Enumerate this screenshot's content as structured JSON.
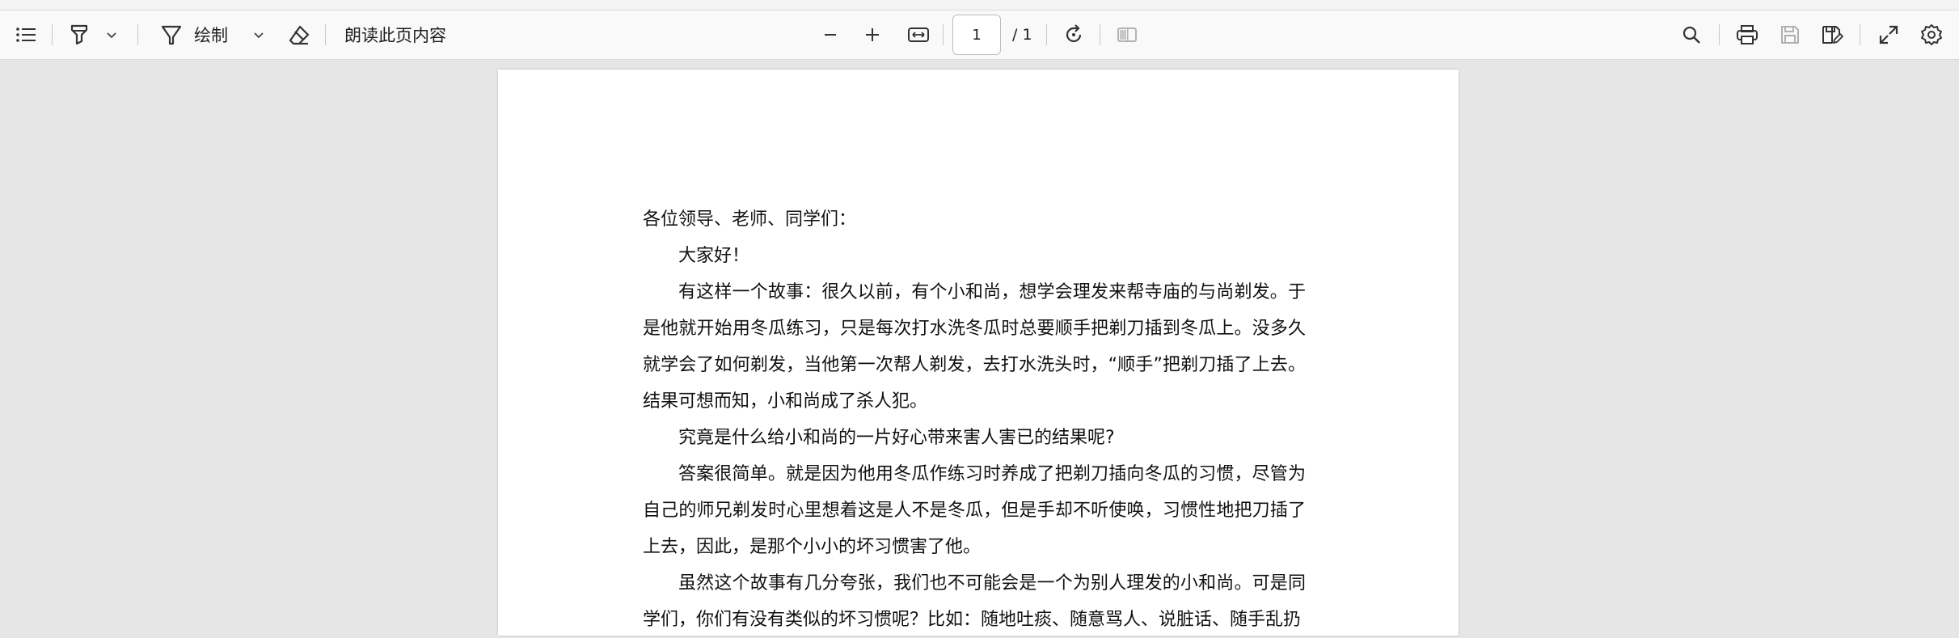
{
  "toolbar": {
    "draw_label": "绘制",
    "read_aloud_label": "朗读此页内容",
    "page_current": "1",
    "page_total": "/ 1"
  },
  "document": {
    "salutation": "各位领导、老师、同学们：",
    "paragraphs": [
      "大家好！",
      "有这样一个故事：很久以前，有个小和尚，想学会理发来帮寺庙的与尚剃发。于是他就开始用冬瓜练习，只是每次打水洗冬瓜时总要顺手把剃刀插到冬瓜上。没多久就学会了如何剃发，当他第一次帮人剃发，去打水洗头时，“顺手”把剃刀插了上去。结果可想而知，小和尚成了杀人犯。",
      "究竟是什么给小和尚的一片好心带来害人害已的结果呢?",
      "答案很简单。就是因为他用冬瓜作练习时养成了把剃刀插向冬瓜的习惯，尽管为自己的师兄剃发时心里想着这是人不是冬瓜，但是手却不听使唤，习惯性地把刀插了上去，因此，是那个小小的坏习惯害了他。",
      "虽然这个故事有几分夸张，我们也不可能会是一个为别人理发的小和尚。可是同学们，你们有没有类似的坏习惯呢？比如：随地吐痰、随意骂人、说脏话、随手乱扔"
    ]
  }
}
